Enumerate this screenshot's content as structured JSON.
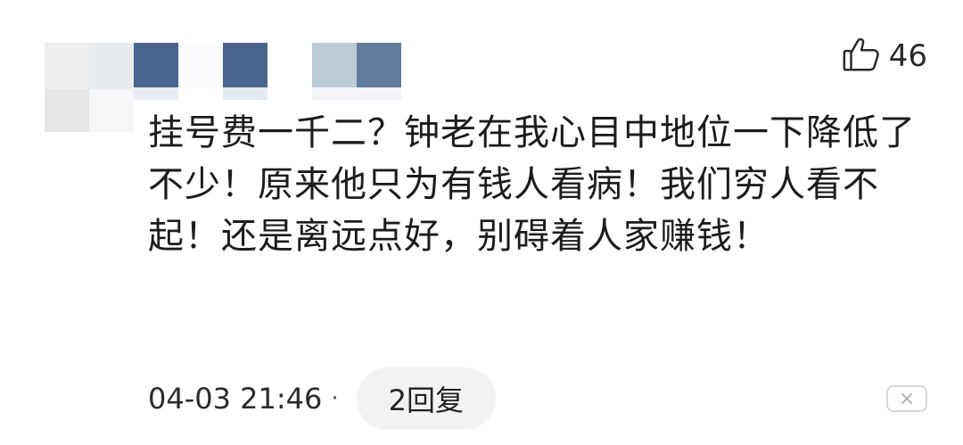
{
  "like": {
    "icon": "thumbs-up-icon",
    "count": "46"
  },
  "comment": {
    "text": "挂号费一千二？钟老在我心目中地位一下降低了不少！原来他只为有钱人看病！我们穷人看不起！还是离远点好，别碍着人家赚钱！"
  },
  "meta": {
    "timestamp": "04-03 21:46",
    "separator": "·",
    "reply_label": "2回复"
  },
  "dismiss": {
    "icon": "close-icon",
    "label": "×"
  },
  "avatar_colors": [
    "#e6e6e6",
    "#e9edef",
    "#4a6690",
    "#4a6690",
    "#bfcfdb",
    "#6480a0"
  ]
}
